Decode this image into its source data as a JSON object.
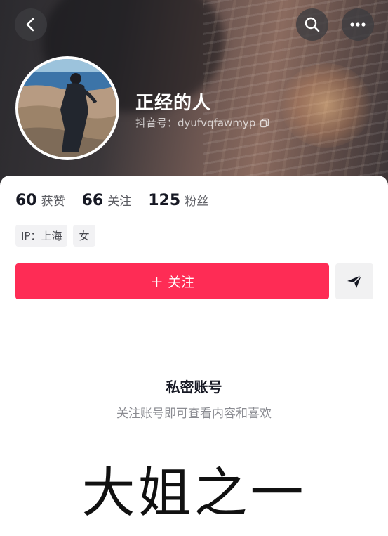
{
  "header": {
    "back_icon": "chevron-left-icon",
    "search_icon": "search-icon",
    "more_icon": "more-dots-icon"
  },
  "profile": {
    "nickname": "正经的人",
    "douyin_id": "抖音号：dyufvqfawmyp",
    "copy_icon": "copy-icon"
  },
  "stats": [
    {
      "value": "60",
      "label": "获赞"
    },
    {
      "value": "66",
      "label": "关注"
    },
    {
      "value": "125",
      "label": "粉丝"
    }
  ],
  "tags": [
    "IP：上海",
    "女"
  ],
  "actions": {
    "follow_label": "＋ 关注",
    "share_icon": "send-icon"
  },
  "private": {
    "title": "私密账号",
    "subtitle": "关注账号即可查看内容和喜欢"
  },
  "caption": "大姐之一",
  "colors": {
    "accent": "#fe2c55",
    "text_primary": "#161823",
    "text_secondary": "#8a8b91"
  }
}
